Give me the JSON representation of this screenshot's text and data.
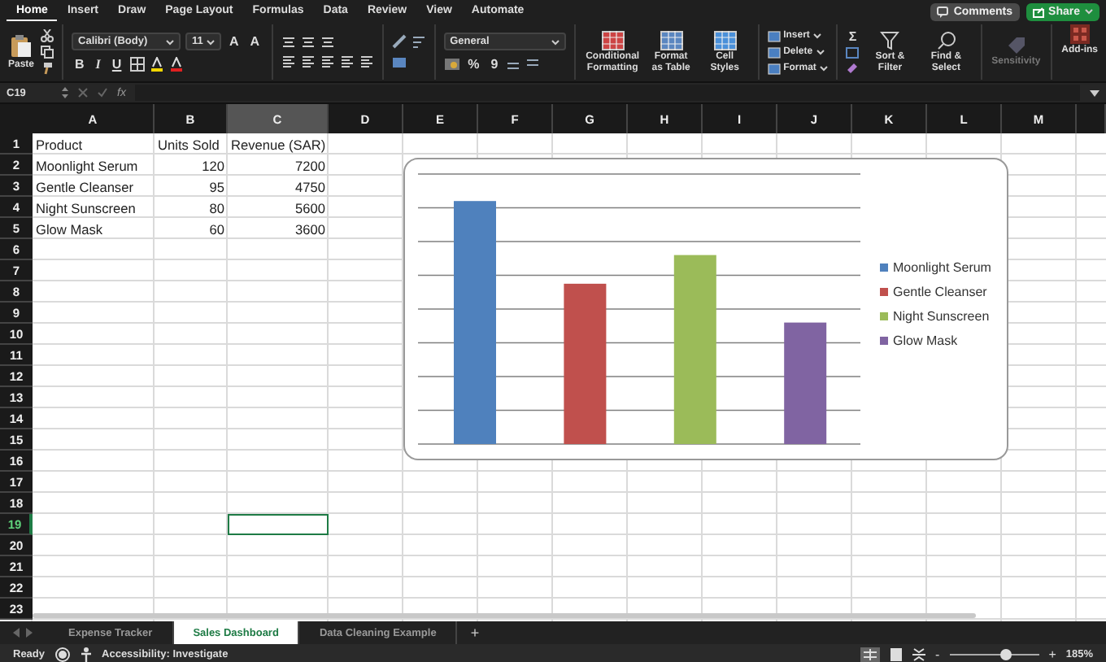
{
  "menu_tabs": [
    {
      "label": "Home",
      "selected": true
    },
    {
      "label": "Insert",
      "selected": false
    },
    {
      "label": "Draw",
      "selected": false
    },
    {
      "label": "Page Layout",
      "selected": false
    },
    {
      "label": "Formulas",
      "selected": false
    },
    {
      "label": "Data",
      "selected": false
    },
    {
      "label": "Review",
      "selected": false
    },
    {
      "label": "View",
      "selected": false
    },
    {
      "label": "Automate",
      "selected": false
    }
  ],
  "top_buttons": {
    "comments": "Comments",
    "share": "Share"
  },
  "ribbon": {
    "paste": "Paste",
    "font": "Calibri (Body)",
    "font_size": "11",
    "font_size_buttons": [
      "A",
      "A"
    ],
    "format_buttons": [
      "B",
      "I",
      "U"
    ],
    "number_format": "General",
    "percent": "%",
    "comma": "9",
    "styles": [
      {
        "label": "Conditional Formatting"
      },
      {
        "label": "Format as Table"
      },
      {
        "label": "Cell Styles"
      }
    ],
    "cells": [
      "Insert",
      "Delete",
      "Format"
    ],
    "autosum": "Σ",
    "sort": "Sort & Filter",
    "find": "Find & Select",
    "sensitivity": {
      "label": "Sensitivity",
      "disabled": true
    },
    "addins": "Add-ins"
  },
  "formula_bar": {
    "name_box": "C19",
    "fx": "fx"
  },
  "sheet": {
    "columns": [
      {
        "letter": "A",
        "selected": false
      },
      {
        "letter": "B",
        "selected": false
      },
      {
        "letter": "C",
        "selected": true
      },
      {
        "letter": "D",
        "selected": false
      },
      {
        "letter": "E",
        "selected": false
      },
      {
        "letter": "F",
        "selected": false
      },
      {
        "letter": "G",
        "selected": false
      },
      {
        "letter": "H",
        "selected": false
      },
      {
        "letter": "I",
        "selected": false
      },
      {
        "letter": "J",
        "selected": false
      },
      {
        "letter": "K",
        "selected": false
      },
      {
        "letter": "L",
        "selected": false
      },
      {
        "letter": "M",
        "selected": false
      }
    ],
    "rows": [
      {
        "number": "1",
        "selected": false,
        "cells": [
          "Product",
          "Units Sold",
          "Revenue (SAR)"
        ]
      },
      {
        "number": "2",
        "selected": false,
        "cells": [
          "Moonlight Serum",
          "120",
          "7200"
        ]
      },
      {
        "number": "3",
        "selected": false,
        "cells": [
          "Gentle Cleanser",
          "95",
          "4750"
        ]
      },
      {
        "number": "4",
        "selected": false,
        "cells": [
          "Night Sunscreen",
          "80",
          "5600"
        ]
      },
      {
        "number": "5",
        "selected": false,
        "cells": [
          "Glow Mask",
          "60",
          "3600"
        ]
      },
      {
        "number": "6",
        "selected": false
      },
      {
        "number": "7",
        "selected": false
      },
      {
        "number": "8",
        "selected": false
      },
      {
        "number": "9",
        "selected": false
      },
      {
        "number": "10",
        "selected": false
      },
      {
        "number": "11",
        "selected": false
      },
      {
        "number": "12",
        "selected": false
      },
      {
        "number": "13",
        "selected": false
      },
      {
        "number": "14",
        "selected": false
      },
      {
        "number": "15",
        "selected": false
      },
      {
        "number": "16",
        "selected": false
      },
      {
        "number": "17",
        "selected": false
      },
      {
        "number": "18",
        "selected": false
      },
      {
        "number": "19",
        "selected": true
      },
      {
        "number": "20",
        "selected": false
      },
      {
        "number": "21",
        "selected": false
      },
      {
        "number": "22",
        "selected": false
      },
      {
        "number": "23",
        "selected": false
      }
    ]
  },
  "chart": {
    "legend": [
      {
        "label": "Moonlight Serum",
        "color": "#4f81bd"
      },
      {
        "label": "Gentle Cleanser",
        "color": "#c0504d"
      },
      {
        "label": "Night Sunscreen",
        "color": "#9bbb59"
      },
      {
        "label": "Glow Mask",
        "color": "#8064a2"
      }
    ]
  },
  "sheet_tabs": {
    "tabs": [
      {
        "label": "Expense Tracker",
        "selected": false
      },
      {
        "label": "Sales Dashboard",
        "selected": true
      },
      {
        "label": "Data Cleaning Example",
        "selected": false
      }
    ],
    "add": "+"
  },
  "status_bar": {
    "ready": "Ready",
    "accessibility": "Accessibility: Investigate",
    "zoom_minus": "-",
    "zoom_plus": "+",
    "zoom": {
      "level": 0.63
    },
    "zoom_label": "185%"
  }
}
